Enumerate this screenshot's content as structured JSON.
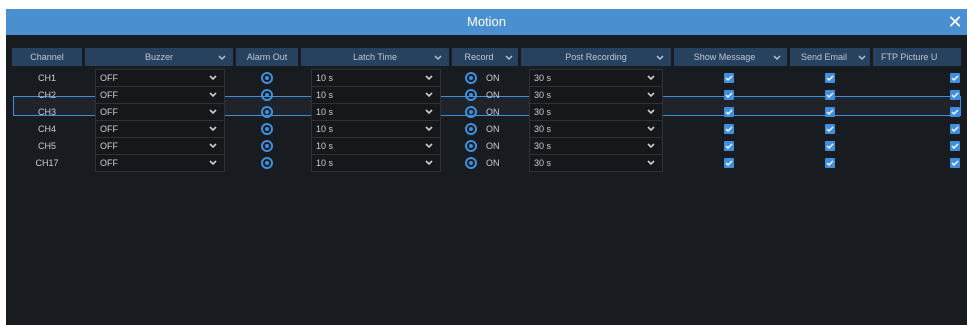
{
  "dialog": {
    "title": "Motion",
    "close_icon": "close-icon"
  },
  "table": {
    "headers": {
      "channel": "Channel",
      "buzzer": "Buzzer",
      "alarm_out": "Alarm Out",
      "latch_time": "Latch Time",
      "record": "Record",
      "post_recording": "Post Recording",
      "show_message": "Show Message",
      "send_email": "Send Email",
      "ftp_picture": "FTP Picture U"
    },
    "rows": [
      {
        "channel": "CH1",
        "buzzer": "OFF",
        "latch": "10 s",
        "record": "ON",
        "post": "30 s"
      },
      {
        "channel": "CH2",
        "buzzer": "OFF",
        "latch": "10 s",
        "record": "ON",
        "post": "30 s"
      },
      {
        "channel": "CH3",
        "buzzer": "OFF",
        "latch": "10 s",
        "record": "ON",
        "post": "30 s"
      },
      {
        "channel": "CH4",
        "buzzer": "OFF",
        "latch": "10 s",
        "record": "ON",
        "post": "30 s"
      },
      {
        "channel": "CH5",
        "buzzer": "OFF",
        "latch": "10 s",
        "record": "ON",
        "post": "30 s"
      },
      {
        "channel": "CH17",
        "buzzer": "OFF",
        "latch": "10 s",
        "record": "ON",
        "post": "30 s"
      }
    ],
    "selected_row": "CH5"
  },
  "colors": {
    "accent": "#3f8fde",
    "titlebar": "#4a8fd0",
    "header": "#27425f",
    "background": "#181b20"
  }
}
